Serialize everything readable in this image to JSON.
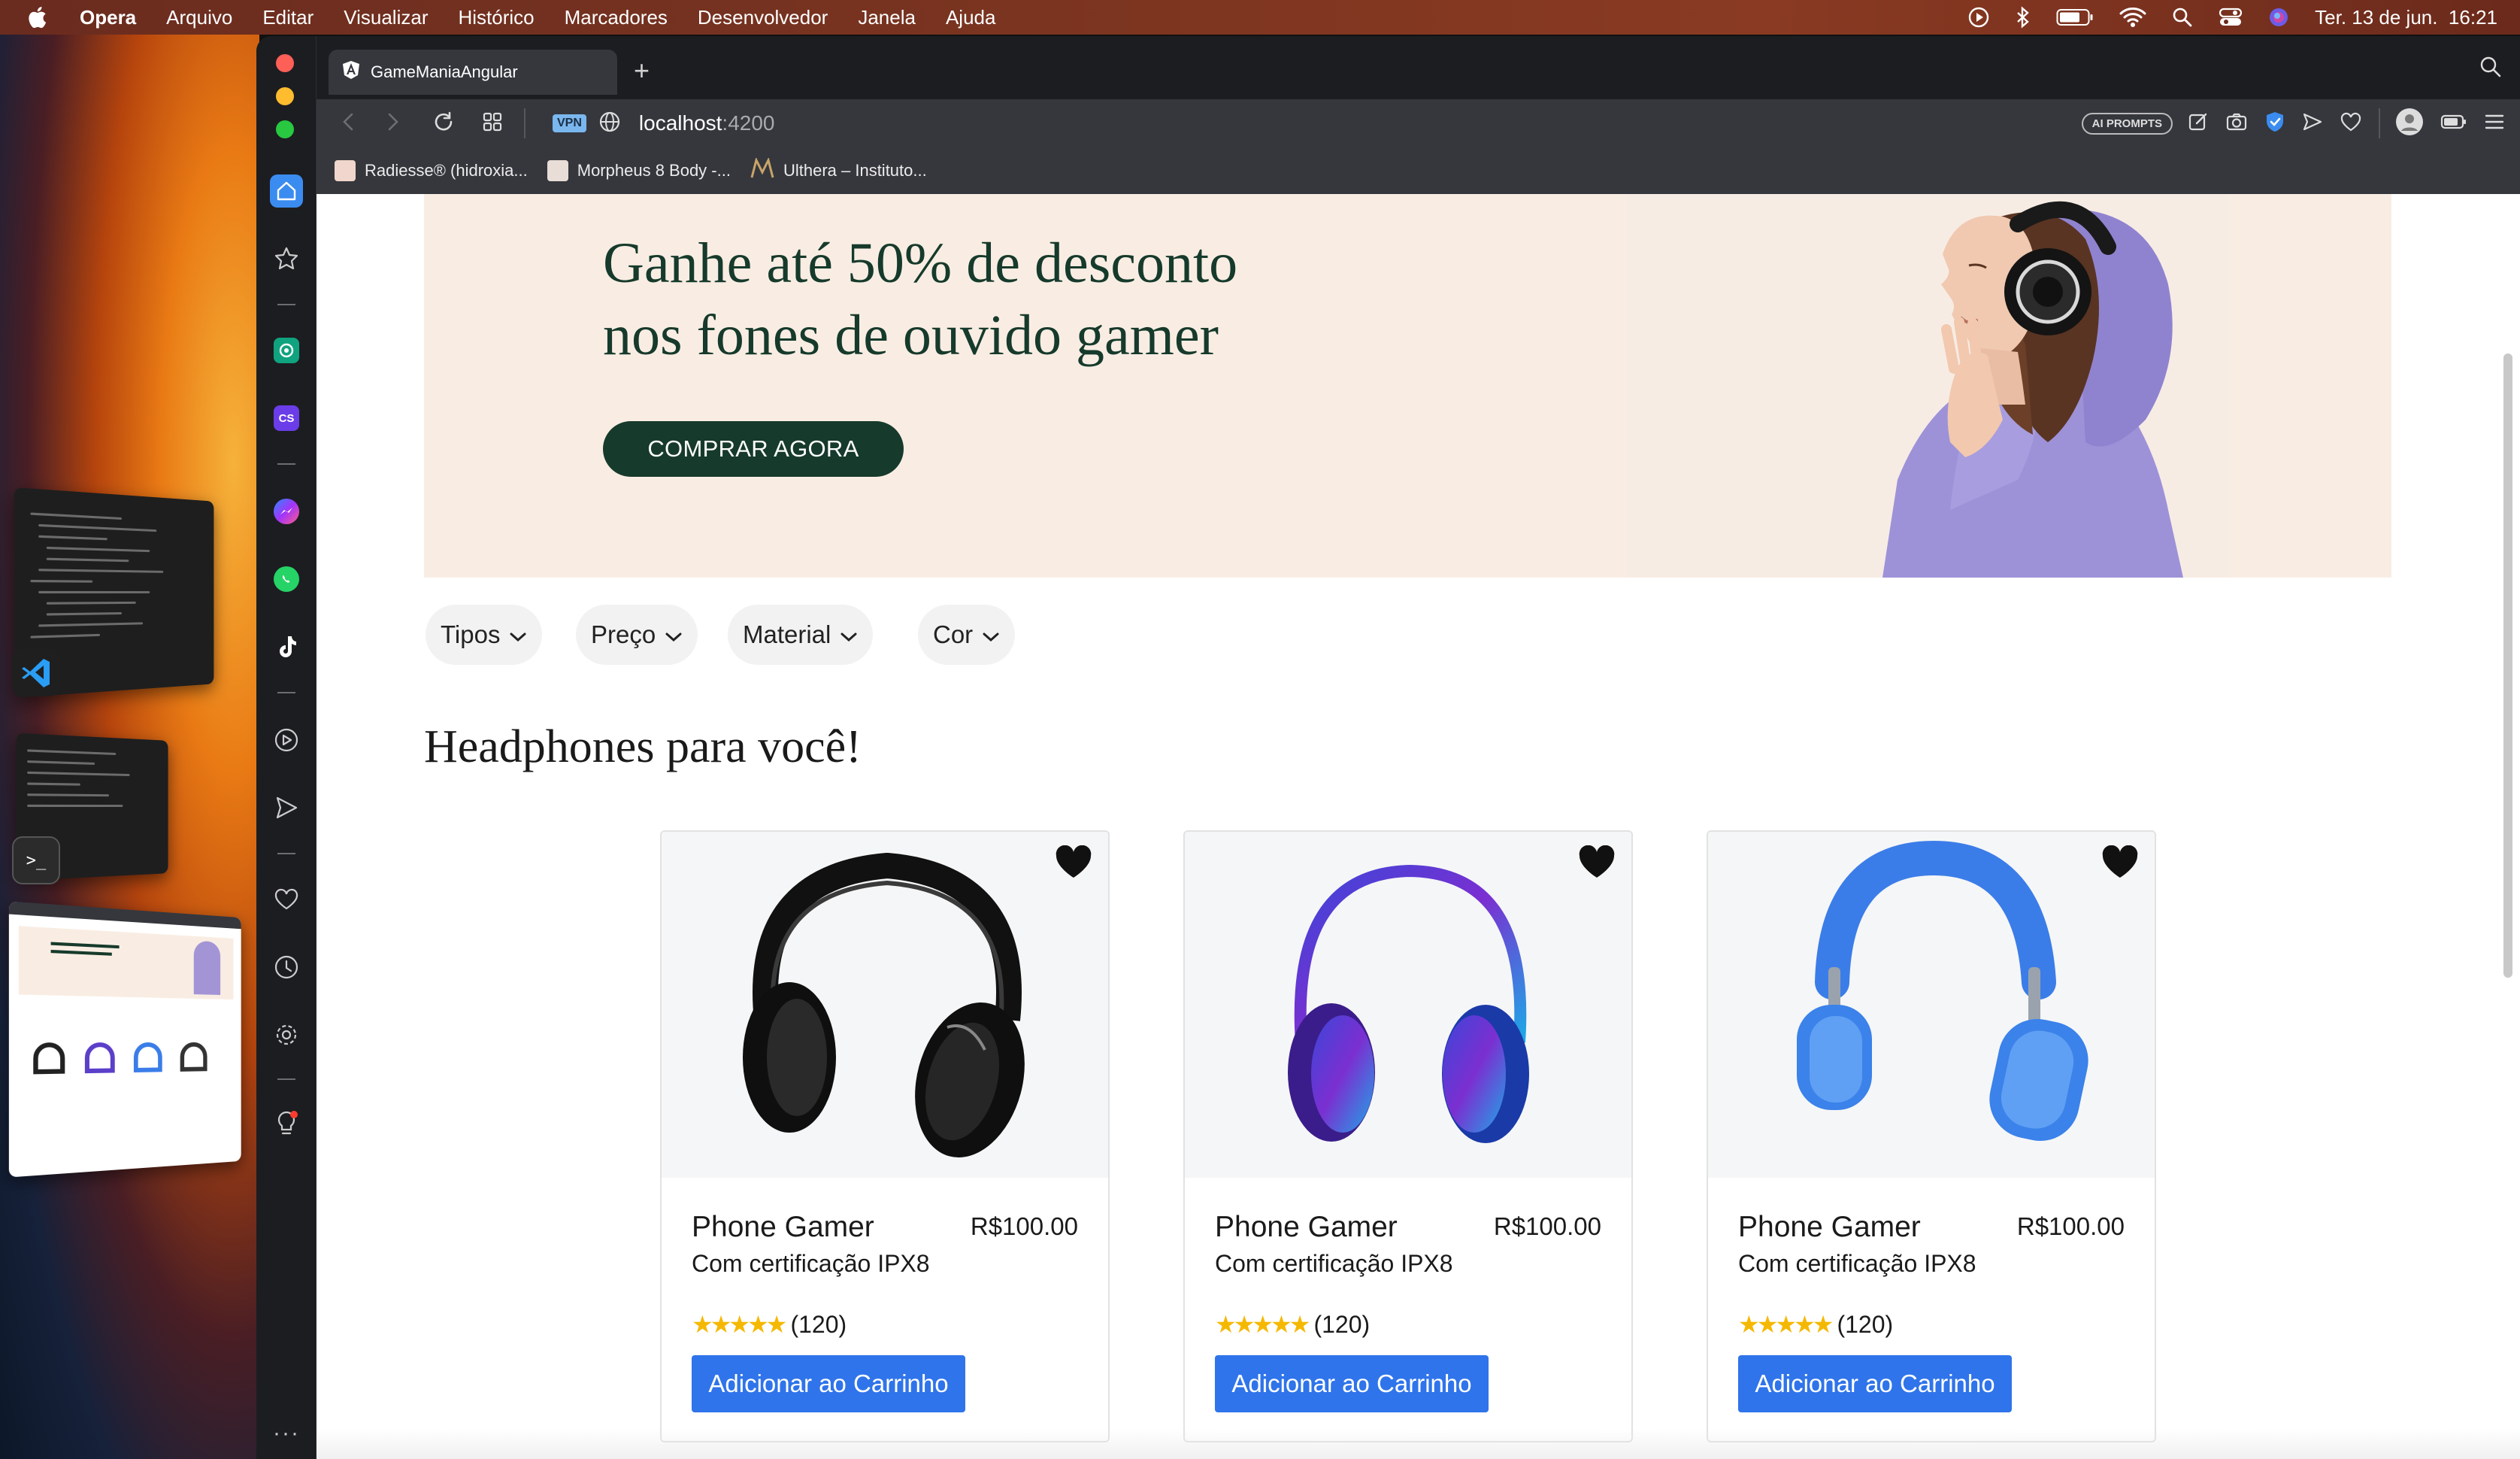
{
  "menubar": {
    "app_name": "Opera",
    "items": [
      "Arquivo",
      "Editar",
      "Visualizar",
      "Histórico",
      "Marcadores",
      "Desenvolvedor",
      "Janela",
      "Ajuda"
    ],
    "datetime": "Ter. 13 de jun.  16:21"
  },
  "browser": {
    "tab_title": "GameManiaAngular",
    "new_tab_symbol": "+",
    "url_host": "localhost",
    "url_port": ":4200",
    "vpn_label": "VPN",
    "ai_prompts_label": "AI PROMPTS",
    "bookmarks": [
      "Radiesse® (hidroxia...",
      "Morpheus 8 Body -...",
      "Ulthera – Instituto..."
    ]
  },
  "hero": {
    "title_line1": "Ganhe até 50% de desconto",
    "title_line2": "nos fones de ouvido gamer",
    "cta_label": "COMPRAR AGORA",
    "bg_color": "#f9ede3",
    "accent_color": "#163a2b"
  },
  "filters": [
    "Tipos",
    "Preço",
    "Material",
    "Cor"
  ],
  "section_title": "Headphones para você!",
  "products": [
    {
      "name": "Phone Gamer",
      "price": "R$100.00",
      "description": "Com certificação IPX8",
      "stars": 5,
      "reviews": "(120)",
      "cta": "Adicionar ao Carrinho",
      "image": "black-headphones"
    },
    {
      "name": "Phone Gamer",
      "price": "R$100.00",
      "description": "Com certificação IPX8",
      "stars": 5,
      "reviews": "(120)",
      "cta": "Adicionar ao Carrinho",
      "image": "purple-blue-headphones"
    },
    {
      "name": "Phone Gamer",
      "price": "R$100.00",
      "description": "Com certificação IPX8",
      "stars": 5,
      "reviews": "(120)",
      "cta": "Adicionar ao Carrinho",
      "image": "blue-max-headphones"
    }
  ],
  "colors": {
    "cart_button": "#2f74ea",
    "star": "#f5b800"
  }
}
